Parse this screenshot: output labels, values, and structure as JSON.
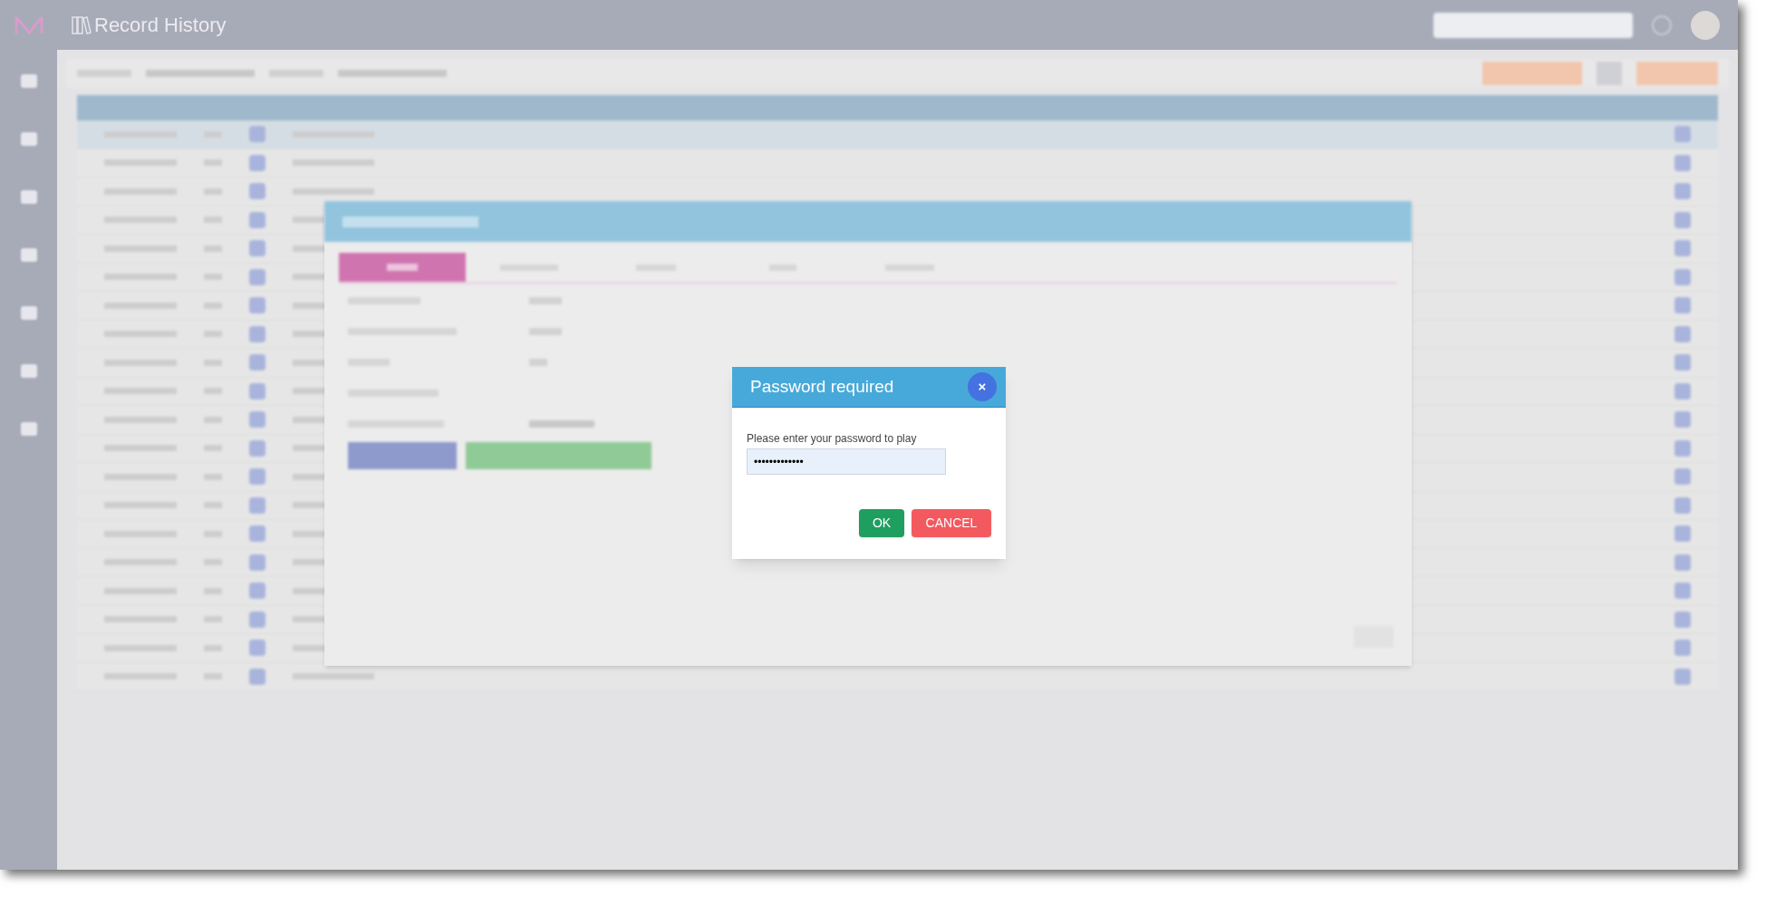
{
  "header": {
    "title": "Record History"
  },
  "password_dialog": {
    "title": "Password required",
    "close": "×",
    "prompt": "Please enter your password to play",
    "value": "•••••••••••••",
    "buttons": [
      {
        "label": "OK",
        "kind": "confirm"
      },
      {
        "label": "CANCEL",
        "kind": "cancel"
      }
    ]
  }
}
